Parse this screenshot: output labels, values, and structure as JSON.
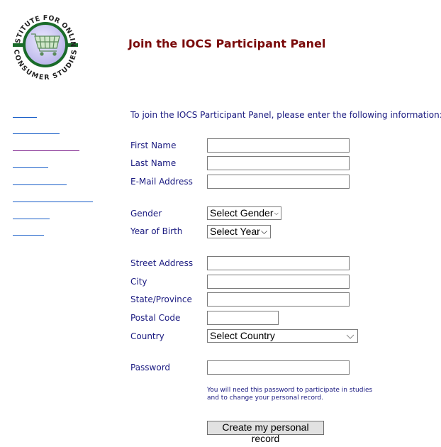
{
  "logo": {
    "top_text": "INSTITUTE FOR ONLINE",
    "bottom_text": "CONSUMER STUDIES",
    "icon": "shopping-cart-icon",
    "colors": {
      "ring": "#1a6b2a",
      "fill": "#c9c6f0",
      "text": "#222222"
    }
  },
  "header": {
    "title": "Join the IOCS Participant Panel",
    "title_color": "#7a0a0a"
  },
  "sidebar": {
    "links": [
      {
        "label": "",
        "visited": false
      },
      {
        "label": "",
        "visited": false
      },
      {
        "label": "",
        "visited": true
      },
      {
        "label": "",
        "visited": false
      },
      {
        "label": "",
        "visited": false
      },
      {
        "label": "",
        "visited": false
      },
      {
        "label": "",
        "visited": false
      },
      {
        "label": "",
        "visited": false
      }
    ],
    "link_color": "#1a5fc8",
    "visited_color": "#7a1a8a"
  },
  "form": {
    "intro": "To join the IOCS Participant Panel, please enter the following information:",
    "first_name": {
      "label": "First Name",
      "value": ""
    },
    "last_name": {
      "label": "Last Name",
      "value": ""
    },
    "email": {
      "label": "E-Mail Address",
      "value": ""
    },
    "gender": {
      "label": "Gender",
      "selected": "Select Gender"
    },
    "year_of_birth": {
      "label": "Year of Birth",
      "selected": "Select Year"
    },
    "street": {
      "label": "Street Address",
      "value": ""
    },
    "city": {
      "label": "City",
      "value": ""
    },
    "state": {
      "label": "State/Province",
      "value": ""
    },
    "postal": {
      "label": "Postal Code",
      "value": ""
    },
    "country": {
      "label": "Country",
      "selected": "Select Country"
    },
    "password": {
      "label": "Password",
      "value": ""
    },
    "password_hint": "You will need this password to participate in studies and to change your personal record.",
    "submit_label": "Create my personal record",
    "label_color": "#1a1a80"
  }
}
